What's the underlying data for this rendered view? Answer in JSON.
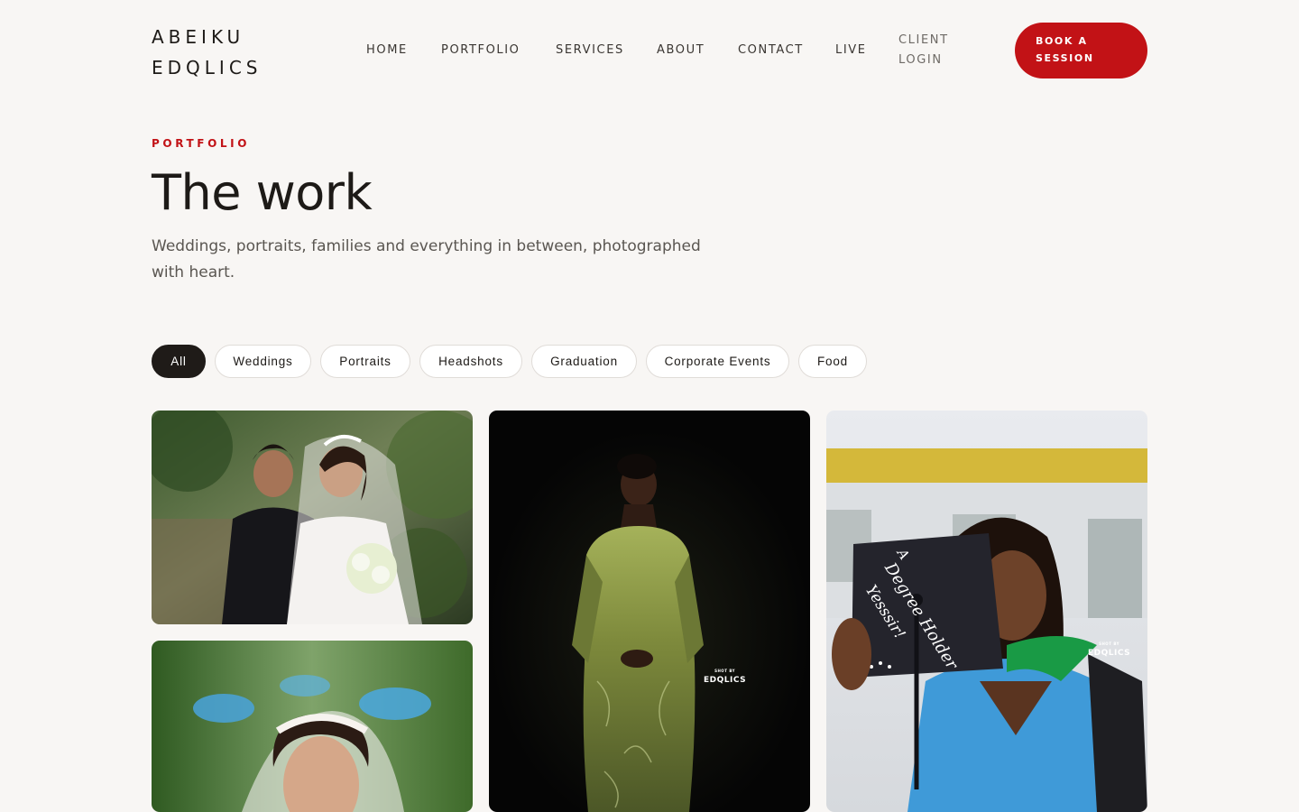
{
  "brand": {
    "line1": "ABEIKU",
    "line2": "EDQLICS"
  },
  "nav": {
    "items": [
      {
        "label": "HOME"
      },
      {
        "label": "PORTFOLIO"
      },
      {
        "label": "SERVICES"
      },
      {
        "label": "ABOUT"
      },
      {
        "label": "CONTACT"
      },
      {
        "label": "LIVE"
      }
    ],
    "client_login": {
      "line1": "CLIENT",
      "line2": "LOGIN"
    },
    "cta": {
      "line1": "BOOK A",
      "line2": "SESSION"
    }
  },
  "intro": {
    "eyebrow": "PORTFOLIO",
    "title": "The work",
    "lead": "Weddings, portraits, families and everything in between, photographed with heart."
  },
  "filters": [
    {
      "label": "All",
      "active": true
    },
    {
      "label": "Weddings",
      "active": false
    },
    {
      "label": "Portraits",
      "active": false
    },
    {
      "label": "Headshots",
      "active": false
    },
    {
      "label": "Graduation",
      "active": false
    },
    {
      "label": "Corporate Events",
      "active": false
    },
    {
      "label": "Food",
      "active": false
    }
  ],
  "gallery": {
    "watermark": {
      "top": "SHOT BY",
      "name": "EDQLICS"
    },
    "grad_cap_lines": [
      "A",
      "Degree Holder",
      "Yesssir!"
    ]
  },
  "colors": {
    "accent": "#c21216",
    "background": "#f8f6f4",
    "text": "#1d1a17",
    "active_filter": "#1f1b18"
  }
}
